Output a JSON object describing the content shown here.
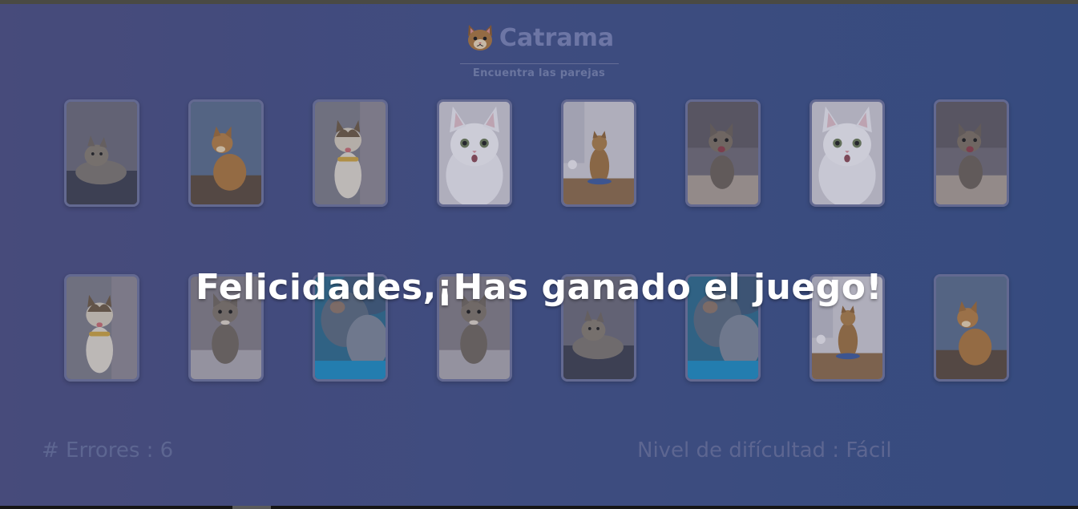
{
  "app": {
    "title": "Catrama",
    "subtitle": "Encuentra las parejas",
    "logo_icon": "cat-face-icon"
  },
  "board": {
    "rows": [
      [
        {
          "photo": "tabby-cat-lying-on-couch"
        },
        {
          "photo": "orange-tabby-cat-sitting"
        },
        {
          "photo": "white-brown-cat-tongue-out"
        },
        {
          "photo": "white-cat-surprised-face"
        },
        {
          "photo": "tabby-cat-sitting-in-kitchen"
        },
        {
          "photo": "tabby-kitten-meowing"
        },
        {
          "photo": "white-cat-surprised-face"
        },
        {
          "photo": "tabby-kitten-meowing"
        }
      ],
      [
        {
          "photo": "white-brown-cat-tongue-out"
        },
        {
          "photo": "tabby-kitten-sitting-on-rug"
        },
        {
          "photo": "blurry-cat-blue-background"
        },
        {
          "photo": "tabby-kitten-sitting-on-rug"
        },
        {
          "photo": "tabby-cat-lying-on-couch"
        },
        {
          "photo": "blurry-cat-blue-background"
        },
        {
          "photo": "tabby-cat-sitting-in-kitchen"
        },
        {
          "photo": "orange-tabby-cat-sitting"
        }
      ]
    ]
  },
  "stats": {
    "errors_label": "# Errores : 6",
    "level_label": "Nivel de difícultad : Fácil"
  },
  "win_message": "Felicidades,¡Has ganado el juego!",
  "colors": {
    "background_start": "#4a4d80",
    "background_end": "#354e86",
    "accent_text": "#7882b4",
    "message_text": "#ffffff"
  }
}
